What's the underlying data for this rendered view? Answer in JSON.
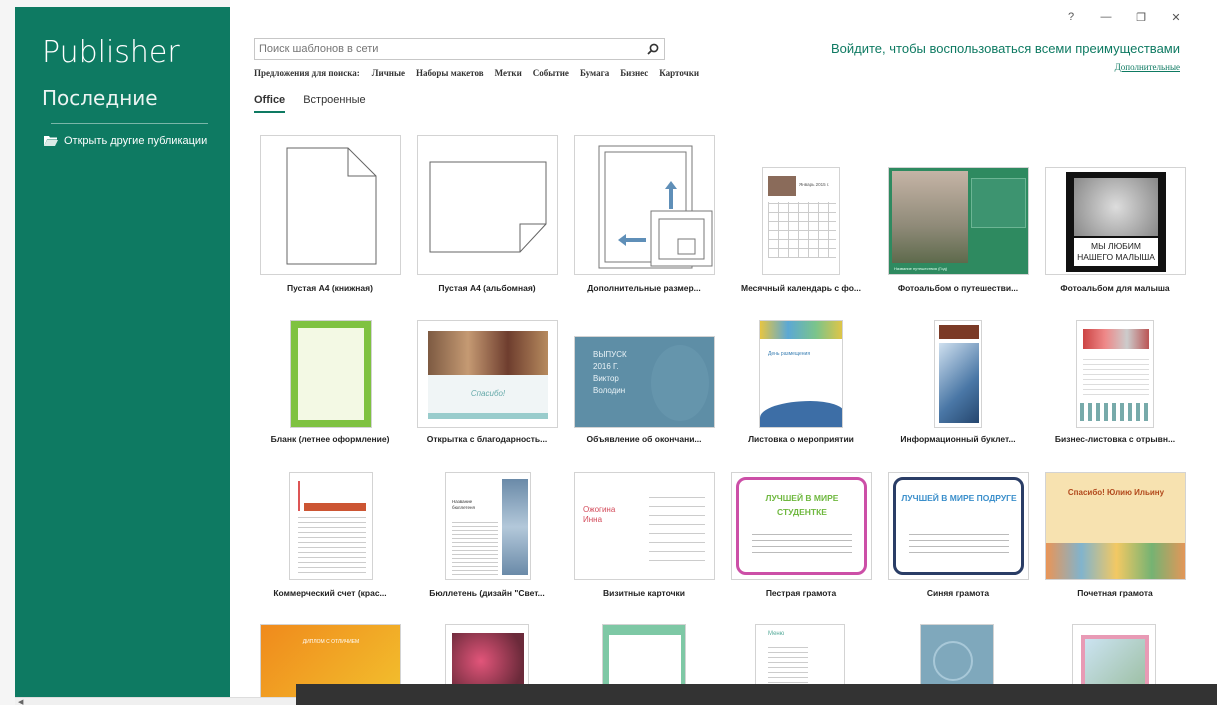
{
  "sidebar": {
    "app_title": "Publisher",
    "section": "Последние",
    "open_other": "Открыть другие публикации"
  },
  "search": {
    "placeholder": "Поиск шаблонов в сети"
  },
  "suggestions": {
    "label": "Предложения для поиска:",
    "items": [
      "Личные",
      "Наборы макетов",
      "Метки",
      "Событие",
      "Бумага",
      "Бизнес",
      "Карточки"
    ]
  },
  "account": {
    "signin": "Войдите, чтобы воспользоваться всеми преимуществами",
    "more": "Дополнительные"
  },
  "window_controls": [
    "?",
    "—",
    "❐",
    "✕"
  ],
  "tabs": [
    "Office",
    "Встроенные"
  ],
  "templates": [
    {
      "name": "Пустая А4 (книжная)",
      "icon": "blank-portrait-icon"
    },
    {
      "name": "Пустая А4 (альбомная)",
      "icon": "blank-landscape-icon"
    },
    {
      "name": "Дополнительные размер...",
      "icon": "more-sizes-icon"
    },
    {
      "name": "Месячный календарь с фо...",
      "thumb_text": "Январь 2015 г."
    },
    {
      "name": "Фотоальбом о путешестви...",
      "thumb_text": "Название путешествия (Год)"
    },
    {
      "name": "Фотоальбом для малыша",
      "thumb_text": "МЫ ЛЮБИМ НАШЕГО МАЛЫША"
    },
    {
      "name": "Бланк (летнее оформление)"
    },
    {
      "name": "Открытка с благодарность...",
      "thumb_text": "Спасибо!"
    },
    {
      "name": "Объявление об окончани...",
      "thumb_text": "ВЫПУСК 2016 Г. Виктор Володин"
    },
    {
      "name": "Листовка о мероприятии",
      "thumb_text": "День размещения"
    },
    {
      "name": "Информационный буклет..."
    },
    {
      "name": "Бизнес-листовка с отрывн..."
    },
    {
      "name": "Коммерческий счет (крас..."
    },
    {
      "name": "Бюллетень (дизайн \"Свет...",
      "thumb_text": "Название бюллетеня"
    },
    {
      "name": "Визитные карточки",
      "thumb_text": "Ожогина Инна"
    },
    {
      "name": "Пестрая грамота",
      "thumb_text": "ЛУЧШЕЙ В МИРЕ СТУДЕНТКЕ"
    },
    {
      "name": "Синяя грамота",
      "thumb_text": "ЛУЧШЕЙ В МИРЕ ПОДРУГЕ"
    },
    {
      "name": "Почетная грамота",
      "thumb_text": "Спасибо! Юлию Ильину"
    },
    {
      "name": "",
      "thumb_text": "ДИПЛОМ С ОТЛИЧИЕМ"
    },
    {
      "name": ""
    },
    {
      "name": ""
    },
    {
      "name": "",
      "thumb_text": "Меню"
    },
    {
      "name": ""
    },
    {
      "name": ""
    }
  ],
  "colors": {
    "accent": "#0e7a62",
    "sidebar_bg": "#0e7a62",
    "overlay": "#333333"
  }
}
